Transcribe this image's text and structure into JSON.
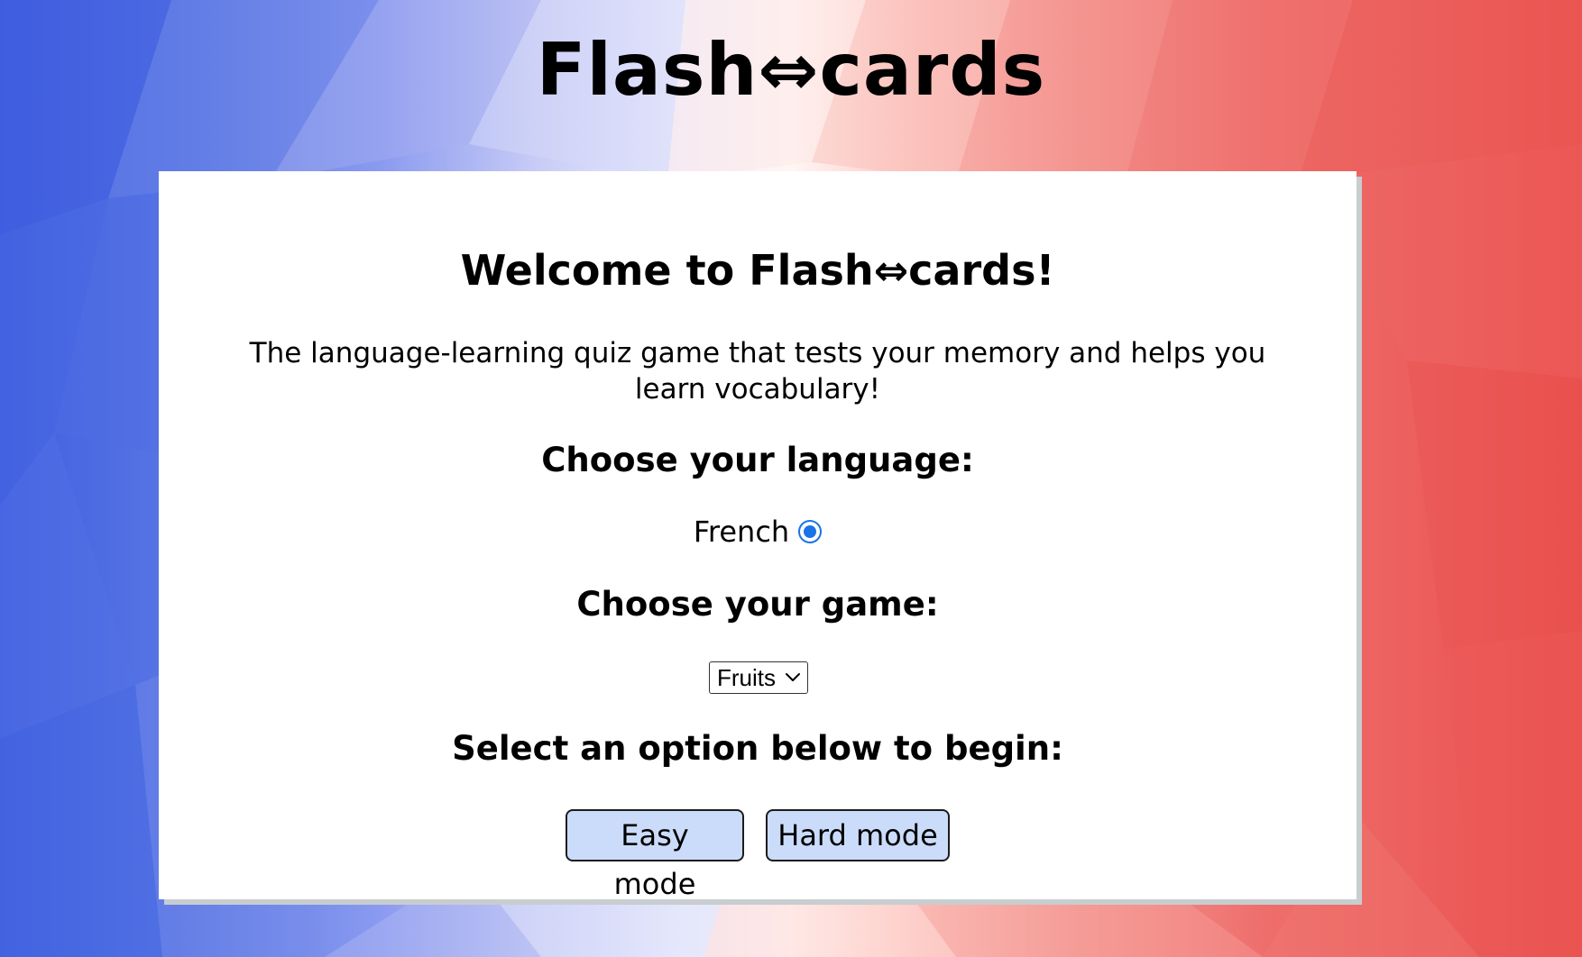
{
  "app": {
    "title": "Flash⇔cards"
  },
  "card": {
    "welcome": "Welcome to Flash⇔cards!",
    "tagline": "The language-learning quiz game that tests your memory and helps you learn vocabulary!",
    "language_heading": "Choose your language:",
    "language_option": {
      "label": "French",
      "selected": true
    },
    "game_heading": "Choose your game:",
    "game_select": {
      "value": "Fruits"
    },
    "begin_heading": "Select an option below to begin:",
    "buttons": {
      "easy": "Easy mode",
      "hard": "Hard mode"
    }
  },
  "colors": {
    "accent": "#1a73e8",
    "button_bg": "#cbdcfa",
    "card_bg": "#ffffff",
    "card_shadow": "#c8cdcf",
    "background_left": "#3f5fe0",
    "background_center": "#fff6f4",
    "background_right": "#ea4f4c"
  },
  "icons": {
    "radio": "radio-selected-icon",
    "select": "chevron-down-icon"
  }
}
